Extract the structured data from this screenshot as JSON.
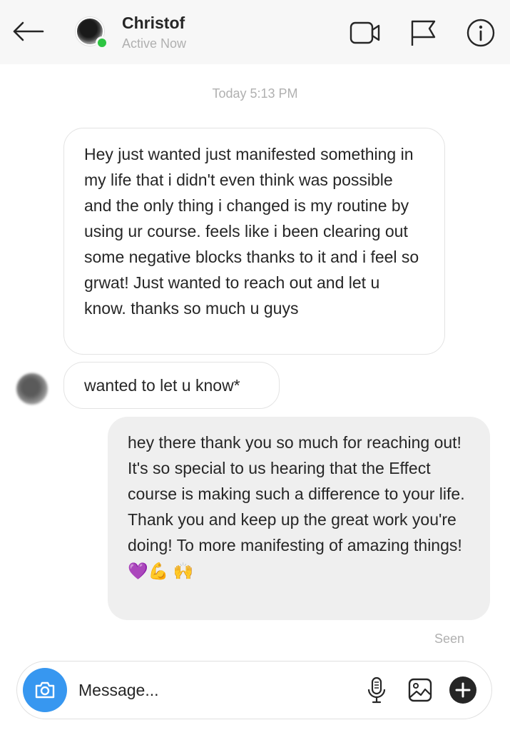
{
  "header": {
    "contact_name": "Christof",
    "contact_status": "Active Now",
    "icons": [
      "back-arrow-icon",
      "video-call-icon",
      "flag-icon",
      "info-icon"
    ]
  },
  "thread": {
    "timestamp": "Today 5:13 PM",
    "messages": [
      {
        "direction": "incoming",
        "text": "Hey just wanted just manifested something in my life that i didn't even think was possible and the only thing i changed is my routine by using ur course. feels like i been clearing out some negative blocks thanks to it and i feel so grwat! Just wanted to reach out and let u know. thanks so much u guys"
      },
      {
        "direction": "incoming",
        "text": "wanted to let u know*"
      },
      {
        "direction": "outgoing",
        "text": "hey there thank you so much for reaching out! It's so special to us hearing that the Effect course is making such a difference to your life. Thank you and keep up the great work you're doing! To more manifesting of amazing things! 💜💪 🙌"
      }
    ],
    "seen_label": "Seen"
  },
  "composer": {
    "placeholder": "Message...",
    "icons": [
      "camera-icon",
      "microphone-icon",
      "image-icon",
      "add-icon"
    ]
  },
  "colors": {
    "accent": "#3797f0",
    "online": "#2ec542",
    "incoming_bg": "#ffffff",
    "outgoing_bg": "#efefef",
    "muted_text": "#b0b0b0"
  }
}
